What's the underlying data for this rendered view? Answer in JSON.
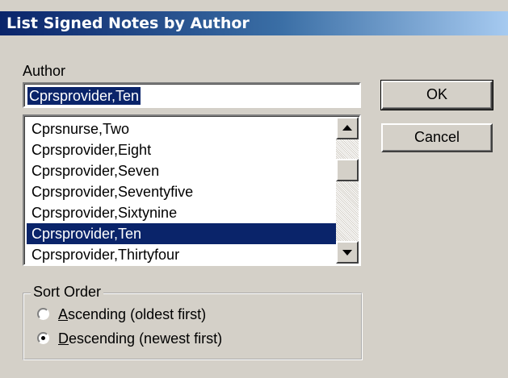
{
  "window": {
    "title": "List Signed Notes by Author"
  },
  "author": {
    "label": "Author",
    "value": "Cprsprovider,Ten"
  },
  "list": {
    "items": [
      "Cprsnurse,Two",
      "Cprsprovider,Eight",
      "Cprsprovider,Seven",
      "Cprsprovider,Seventyfive",
      "Cprsprovider,Sixtynine",
      "Cprsprovider,Ten",
      "Cprsprovider,Thirtyfour"
    ],
    "selected_index": 5
  },
  "buttons": {
    "ok": "OK",
    "cancel": "Cancel"
  },
  "sort_order": {
    "legend": "Sort Order",
    "ascending": {
      "accel": "A",
      "rest": "scending (oldest first)",
      "checked": false
    },
    "descending": {
      "accel": "D",
      "rest": "escending (newest first)",
      "checked": true
    }
  },
  "colors": {
    "face": "#d4d0c8",
    "selection": "#0a246a",
    "title_start": "#0a246a",
    "title_end": "#a6caf0"
  }
}
